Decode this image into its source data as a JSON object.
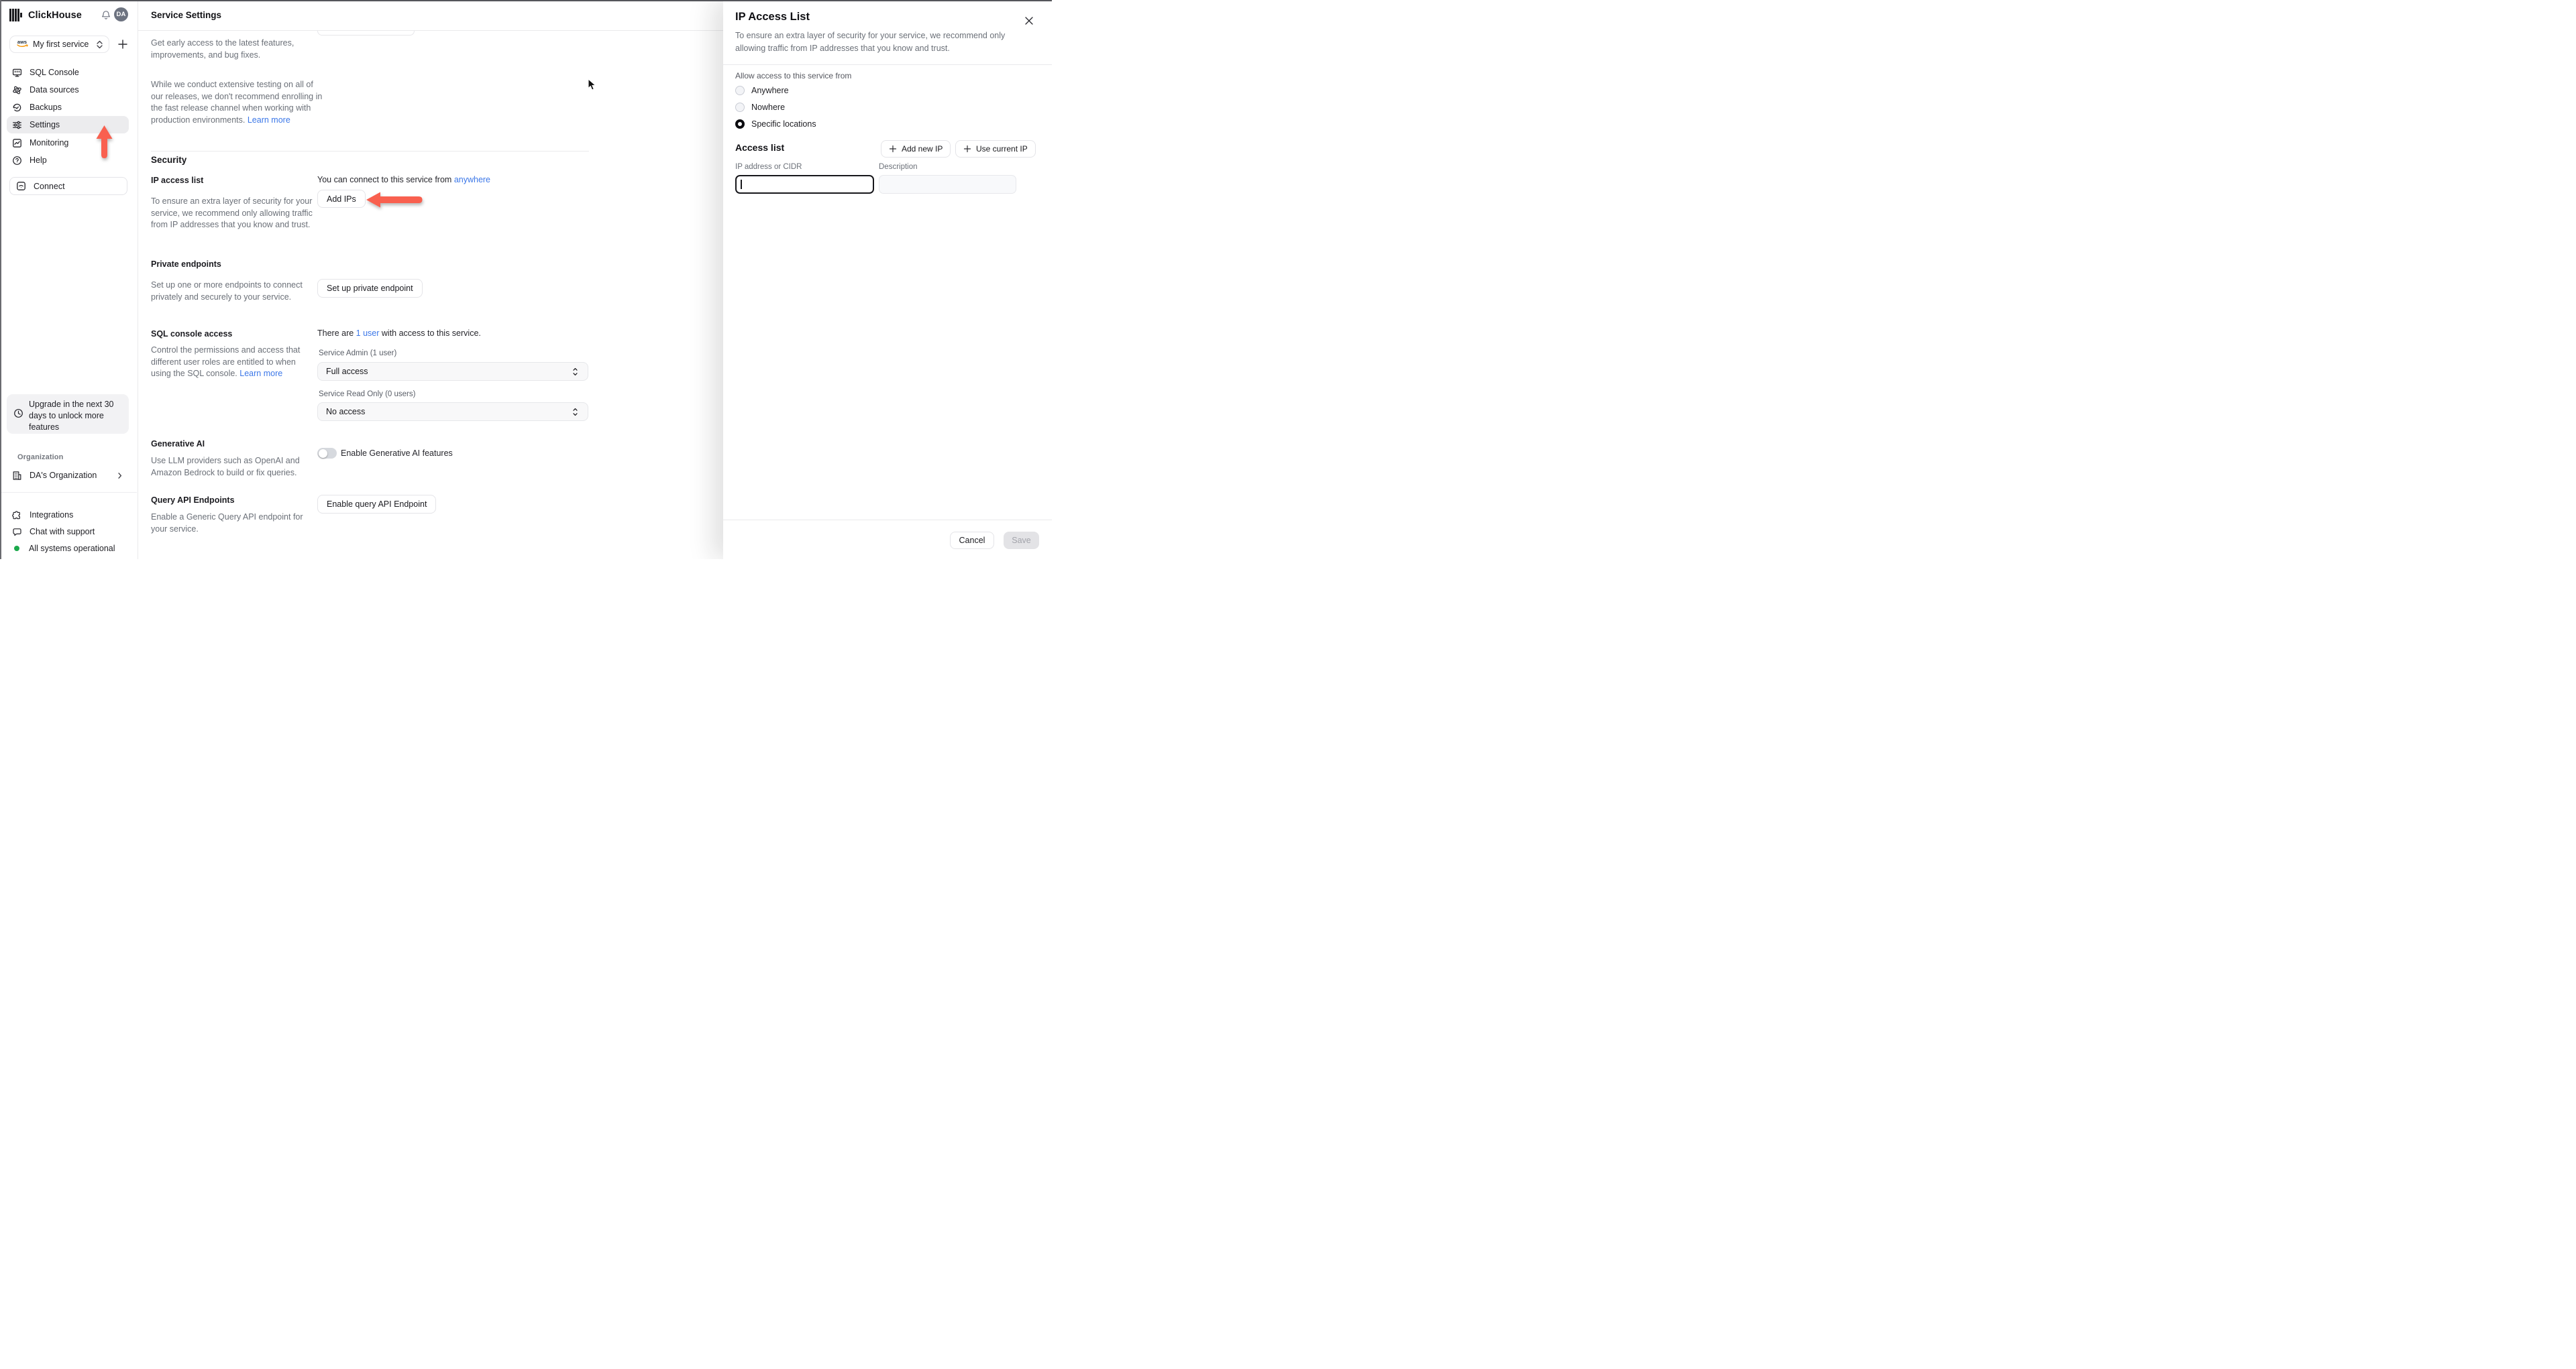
{
  "sidebar": {
    "brand": "ClickHouse",
    "avatar_initials": "DA",
    "service_selector": {
      "provider": "aws",
      "label": "My first service"
    },
    "nav": [
      {
        "label": "SQL Console"
      },
      {
        "label": "Data sources"
      },
      {
        "label": "Backups"
      },
      {
        "label": "Settings"
      },
      {
        "label": "Monitoring"
      },
      {
        "label": "Help"
      }
    ],
    "connect_label": "Connect",
    "upgrade_notice": "Upgrade in the next 30 days to unlock more features",
    "organization_label": "Organization",
    "organization_name": "DA's Organization",
    "footer": {
      "integrations": "Integrations",
      "chat": "Chat with support",
      "status": "All systems operational"
    }
  },
  "main": {
    "title": "Service Settings",
    "release_channel": {
      "para1": "Get early access to the latest features, improvements, and bug fixes.",
      "para2": "While we conduct extensive testing on all of our releases, we don't recommend enrolling in the fast release channel when working with production environments.",
      "learn_more": "Learn more"
    },
    "security": {
      "heading": "Security",
      "ip_access": {
        "label": "IP access list",
        "description": "To ensure an extra layer of security for your service, we recommend only allowing traffic from IP addresses that you know and trust.",
        "status_prefix": "You can connect to this service from ",
        "status_link": "anywhere",
        "button": "Add IPs"
      },
      "private_endpoints": {
        "label": "Private endpoints",
        "description": "Set up one or more endpoints to connect privately and securely to your service.",
        "button": "Set up private endpoint"
      },
      "sql_console": {
        "label": "SQL console access",
        "sentence_prefix": "There are ",
        "sentence_link": "1 user",
        "sentence_suffix": " with access to this service.",
        "description": "Control the permissions and access that different user roles are entitled to when using the SQL console. ",
        "learn_more": "Learn more",
        "admin_label": "Service Admin (1 user)",
        "admin_value": "Full access",
        "readonly_label": "Service Read Only (0 users)",
        "readonly_value": "No access"
      },
      "generative_ai": {
        "label": "Generative AI",
        "toggle_label": "Enable Generative AI features",
        "toggle_state": "off",
        "description": "Use LLM providers such as OpenAI and Amazon Bedrock to build or fix queries."
      },
      "query_api": {
        "label": "Query API Endpoints",
        "button": "Enable query API Endpoint",
        "description": "Enable a Generic Query API endpoint for your service."
      }
    }
  },
  "panel": {
    "title": "IP Access List",
    "description": "To ensure an extra layer of security for your service, we recommend only allowing traffic from IP addresses that you know and trust.",
    "allow_label": "Allow access to this service from",
    "radios": [
      {
        "label": "Anywhere",
        "selected": false
      },
      {
        "label": "Nowhere",
        "selected": false
      },
      {
        "label": "Specific locations",
        "selected": true
      }
    ],
    "access_list_heading": "Access list",
    "add_new_ip": "Add new IP",
    "use_current_ip": "Use current IP",
    "ip_label": "IP address or CIDR",
    "description_label": "Description",
    "ip_value": "",
    "description_value": "",
    "cancel": "Cancel",
    "save": "Save"
  },
  "colors": {
    "accent_red": "#F9604F",
    "link_blue": "#3B77E8",
    "status_green": "#1BA94C",
    "active_nav_bg": "#ECECEE"
  }
}
